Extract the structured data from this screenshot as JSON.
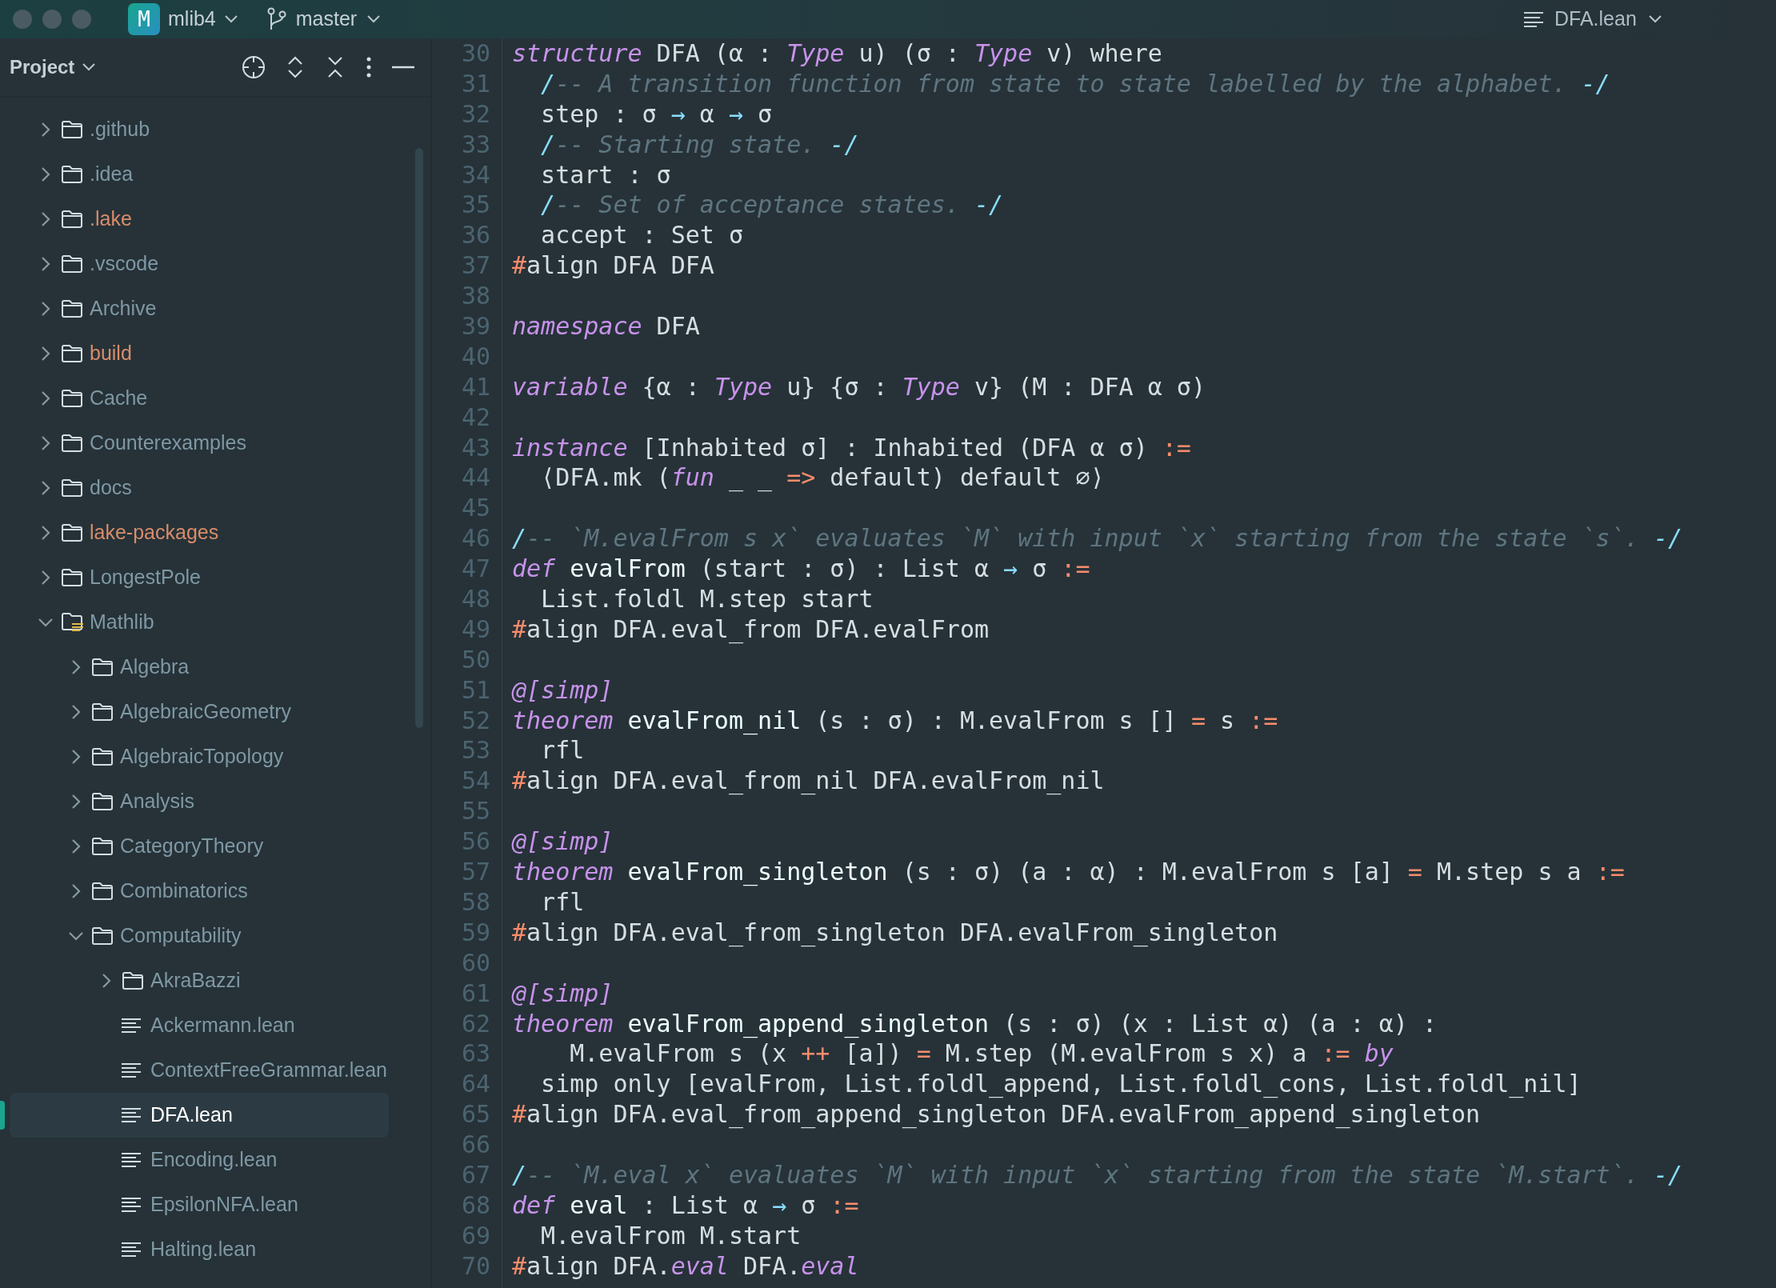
{
  "title_bar": {
    "project_badge": "M",
    "project": "mlib4",
    "branch": "master",
    "open_file": "DFA.lean"
  },
  "project_panel": {
    "title": "Project",
    "tree": [
      {
        "kind": "folder",
        "label": ".github",
        "expanded": false,
        "excluded": false,
        "selected": false
      },
      {
        "kind": "folder",
        "label": ".idea",
        "expanded": false,
        "excluded": false,
        "selected": false
      },
      {
        "kind": "folder",
        "label": ".lake",
        "expanded": false,
        "excluded": true,
        "selected": false
      },
      {
        "kind": "folder",
        "label": ".vscode",
        "expanded": false,
        "excluded": false,
        "selected": false
      },
      {
        "kind": "folder",
        "label": "Archive",
        "expanded": false,
        "excluded": false,
        "selected": false
      },
      {
        "kind": "folder",
        "label": "build",
        "expanded": false,
        "excluded": true,
        "selected": false
      },
      {
        "kind": "folder",
        "label": "Cache",
        "expanded": false,
        "excluded": false,
        "selected": false
      },
      {
        "kind": "folder",
        "label": "Counterexamples",
        "expanded": false,
        "excluded": false,
        "selected": false
      },
      {
        "kind": "folder",
        "label": "docs",
        "expanded": false,
        "excluded": false,
        "selected": false
      },
      {
        "kind": "folder",
        "label": "lake-packages",
        "expanded": false,
        "excluded": true,
        "selected": false
      },
      {
        "kind": "folder",
        "label": "LongestPole",
        "expanded": false,
        "excluded": false,
        "selected": false
      },
      {
        "kind": "source-folder",
        "label": "Mathlib",
        "expanded": true,
        "excluded": false,
        "selected": false,
        "children": [
          {
            "kind": "folder",
            "label": "Algebra",
            "expanded": false,
            "excluded": false,
            "selected": false
          },
          {
            "kind": "folder",
            "label": "AlgebraicGeometry",
            "expanded": false,
            "excluded": false,
            "selected": false
          },
          {
            "kind": "folder",
            "label": "AlgebraicTopology",
            "expanded": false,
            "excluded": false,
            "selected": false
          },
          {
            "kind": "folder",
            "label": "Analysis",
            "expanded": false,
            "excluded": false,
            "selected": false
          },
          {
            "kind": "folder",
            "label": "CategoryTheory",
            "expanded": false,
            "excluded": false,
            "selected": false
          },
          {
            "kind": "folder",
            "label": "Combinatorics",
            "expanded": false,
            "excluded": false,
            "selected": false
          },
          {
            "kind": "folder",
            "label": "Computability",
            "expanded": true,
            "excluded": false,
            "selected": false,
            "children": [
              {
                "kind": "folder",
                "label": "AkraBazzi",
                "expanded": false,
                "excluded": false,
                "selected": false
              },
              {
                "kind": "file",
                "label": "Ackermann.lean",
                "excluded": false,
                "selected": false
              },
              {
                "kind": "file",
                "label": "ContextFreeGrammar.lean",
                "excluded": false,
                "selected": false
              },
              {
                "kind": "file",
                "label": "DFA.lean",
                "excluded": false,
                "selected": true
              },
              {
                "kind": "file",
                "label": "Encoding.lean",
                "excluded": false,
                "selected": false
              },
              {
                "kind": "file",
                "label": "EpsilonNFA.lean",
                "excluded": false,
                "selected": false
              },
              {
                "kind": "file",
                "label": "Halting.lean",
                "excluded": false,
                "selected": false
              }
            ]
          }
        ]
      }
    ]
  },
  "editor": {
    "lines": [
      {
        "number": "30",
        "tokens": [
          {
            "kind": "keyword",
            "text": "structure"
          },
          {
            "kind": "text",
            "text": " DFA (α : "
          },
          {
            "kind": "keyword",
            "text": "Type"
          },
          {
            "kind": "text",
            "text": " u) (σ : "
          },
          {
            "kind": "keyword",
            "text": "Type"
          },
          {
            "kind": "text",
            "text": " v) where"
          }
        ]
      },
      {
        "number": "31",
        "tokens": [
          {
            "kind": "delimiter",
            "text": "  /"
          },
          {
            "kind": "comment",
            "text": "-- A transition function from state to state labelled by the alphabet. "
          },
          {
            "kind": "delimiter",
            "text": "-/"
          }
        ]
      },
      {
        "number": "32",
        "tokens": [
          {
            "kind": "text",
            "text": "  step : σ "
          },
          {
            "kind": "arrow",
            "text": "→"
          },
          {
            "kind": "text",
            "text": " α "
          },
          {
            "kind": "arrow",
            "text": "→"
          },
          {
            "kind": "text",
            "text": " σ"
          }
        ]
      },
      {
        "number": "33",
        "tokens": [
          {
            "kind": "delimiter",
            "text": "  /"
          },
          {
            "kind": "comment",
            "text": "-- Starting state. "
          },
          {
            "kind": "delimiter",
            "text": "-/"
          }
        ]
      },
      {
        "number": "34",
        "tokens": [
          {
            "kind": "text",
            "text": "  start : σ"
          }
        ]
      },
      {
        "number": "35",
        "tokens": [
          {
            "kind": "delimiter",
            "text": "  /"
          },
          {
            "kind": "comment",
            "text": "-- Set of acceptance states. "
          },
          {
            "kind": "delimiter",
            "text": "-/"
          }
        ]
      },
      {
        "number": "36",
        "tokens": [
          {
            "kind": "text",
            "text": "  accept : Set σ"
          }
        ]
      },
      {
        "number": "37",
        "tokens": [
          {
            "kind": "hash",
            "text": "#"
          },
          {
            "kind": "text",
            "text": "align DFA DFA"
          }
        ]
      },
      {
        "number": "38"
      },
      {
        "number": "39",
        "tokens": [
          {
            "kind": "keyword",
            "text": "namespace"
          },
          {
            "kind": "text",
            "text": " DFA"
          }
        ]
      },
      {
        "number": "40"
      },
      {
        "number": "41",
        "tokens": [
          {
            "kind": "keyword",
            "text": "variable"
          },
          {
            "kind": "text",
            "text": " {α : "
          },
          {
            "kind": "keyword",
            "text": "Type"
          },
          {
            "kind": "text",
            "text": " u} {σ : "
          },
          {
            "kind": "keyword",
            "text": "Type"
          },
          {
            "kind": "text",
            "text": " v} (M : DFA α σ)"
          }
        ]
      },
      {
        "number": "42"
      },
      {
        "number": "43",
        "tokens": [
          {
            "kind": "keyword",
            "text": "instance"
          },
          {
            "kind": "text",
            "text": " [Inhabited σ] : Inhabited (DFA α σ) "
          },
          {
            "kind": "operator",
            "text": ":="
          }
        ]
      },
      {
        "number": "44",
        "tokens": [
          {
            "kind": "text",
            "text": "  ⟨DFA.mk ("
          },
          {
            "kind": "keyword",
            "text": "fun"
          },
          {
            "kind": "text",
            "text": " _ _ "
          },
          {
            "kind": "operator",
            "text": "=>"
          },
          {
            "kind": "text",
            "text": " default) default ∅⟩"
          }
        ]
      },
      {
        "number": "45"
      },
      {
        "number": "46",
        "tokens": [
          {
            "kind": "delimiter",
            "text": "/"
          },
          {
            "kind": "comment",
            "text": "-- `M.evalFrom s x` evaluates `M` with input `x` starting from the state `s`. "
          },
          {
            "kind": "delimiter",
            "text": "-/"
          }
        ]
      },
      {
        "number": "47",
        "tokens": [
          {
            "kind": "keyword",
            "text": "def"
          },
          {
            "kind": "name",
            "text": " evalFrom"
          },
          {
            "kind": "text",
            "text": " (start : σ) : List α "
          },
          {
            "kind": "arrow",
            "text": "→"
          },
          {
            "kind": "text",
            "text": " σ "
          },
          {
            "kind": "operator",
            "text": ":="
          }
        ]
      },
      {
        "number": "48",
        "tokens": [
          {
            "kind": "text",
            "text": "  List.foldl M.step start"
          }
        ]
      },
      {
        "number": "49",
        "tokens": [
          {
            "kind": "hash",
            "text": "#"
          },
          {
            "kind": "text",
            "text": "align DFA.eval_from DFA.evalFrom"
          }
        ]
      },
      {
        "number": "50"
      },
      {
        "number": "51",
        "tokens": [
          {
            "kind": "attribute",
            "text": "@[simp]"
          }
        ]
      },
      {
        "number": "52",
        "tokens": [
          {
            "kind": "keyword",
            "text": "theorem"
          },
          {
            "kind": "name",
            "text": " evalFrom_nil"
          },
          {
            "kind": "text",
            "text": " (s : σ) : M.evalFrom s [] "
          },
          {
            "kind": "operator",
            "text": "="
          },
          {
            "kind": "text",
            "text": " s "
          },
          {
            "kind": "operator",
            "text": ":="
          }
        ]
      },
      {
        "number": "53",
        "tokens": [
          {
            "kind": "text",
            "text": "  rfl"
          }
        ]
      },
      {
        "number": "54",
        "tokens": [
          {
            "kind": "hash",
            "text": "#"
          },
          {
            "kind": "text",
            "text": "align DFA.eval_from_nil DFA.evalFrom_nil"
          }
        ]
      },
      {
        "number": "55"
      },
      {
        "number": "56",
        "tokens": [
          {
            "kind": "attribute",
            "text": "@[simp]"
          }
        ]
      },
      {
        "number": "57",
        "tokens": [
          {
            "kind": "keyword",
            "text": "theorem"
          },
          {
            "kind": "name",
            "text": " evalFrom_singleton"
          },
          {
            "kind": "text",
            "text": " (s : σ) (a : α) : M.evalFrom s [a] "
          },
          {
            "kind": "operator",
            "text": "="
          },
          {
            "kind": "text",
            "text": " M.step s a "
          },
          {
            "kind": "operator",
            "text": ":="
          }
        ]
      },
      {
        "number": "58",
        "tokens": [
          {
            "kind": "text",
            "text": "  rfl"
          }
        ]
      },
      {
        "number": "59",
        "tokens": [
          {
            "kind": "hash",
            "text": "#"
          },
          {
            "kind": "text",
            "text": "align DFA.eval_from_singleton DFA.evalFrom_singleton"
          }
        ]
      },
      {
        "number": "60"
      },
      {
        "number": "61",
        "tokens": [
          {
            "kind": "attribute",
            "text": "@[simp]"
          }
        ]
      },
      {
        "number": "62",
        "tokens": [
          {
            "kind": "keyword",
            "text": "theorem"
          },
          {
            "kind": "name",
            "text": " evalFrom_append_singleton"
          },
          {
            "kind": "text",
            "text": " (s : σ) (x : List α) (a : α) :"
          }
        ]
      },
      {
        "number": "63",
        "tokens": [
          {
            "kind": "text",
            "text": "    M.evalFrom s (x "
          },
          {
            "kind": "operator",
            "text": "++"
          },
          {
            "kind": "text",
            "text": " [a]) "
          },
          {
            "kind": "operator",
            "text": "="
          },
          {
            "kind": "text",
            "text": " M.step (M.evalFrom s x) a "
          },
          {
            "kind": "operator",
            "text": ":="
          },
          {
            "kind": "keyword",
            "text": " by"
          }
        ]
      },
      {
        "number": "64",
        "tokens": [
          {
            "kind": "text",
            "text": "  simp only [evalFrom, List.foldl_append, List.foldl_cons, List.foldl_nil]"
          }
        ]
      },
      {
        "number": "65",
        "tokens": [
          {
            "kind": "hash",
            "text": "#"
          },
          {
            "kind": "text",
            "text": "align DFA.eval_from_append_singleton DFA.evalFrom_append_singleton"
          }
        ]
      },
      {
        "number": "66"
      },
      {
        "number": "67",
        "tokens": [
          {
            "kind": "delimiter",
            "text": "/"
          },
          {
            "kind": "comment",
            "text": "-- `M.eval x` evaluates `M` with input `x` starting from the state `M.start`. "
          },
          {
            "kind": "delimiter",
            "text": "-/"
          }
        ]
      },
      {
        "number": "68",
        "tokens": [
          {
            "kind": "keyword",
            "text": "def"
          },
          {
            "kind": "name",
            "text": " eval"
          },
          {
            "kind": "text",
            "text": " : List α "
          },
          {
            "kind": "arrow",
            "text": "→"
          },
          {
            "kind": "text",
            "text": " σ "
          },
          {
            "kind": "operator",
            "text": ":="
          }
        ]
      },
      {
        "number": "69",
        "tokens": [
          {
            "kind": "text",
            "text": "  M.evalFrom M.start"
          }
        ]
      },
      {
        "number": "70",
        "tokens": [
          {
            "kind": "hash",
            "text": "#"
          },
          {
            "kind": "text",
            "text": "align DFA."
          },
          {
            "kind": "keyword",
            "text": "eval"
          },
          {
            "kind": "text",
            "text": " DFA."
          },
          {
            "kind": "keyword",
            "text": "eval"
          }
        ]
      }
    ]
  }
}
